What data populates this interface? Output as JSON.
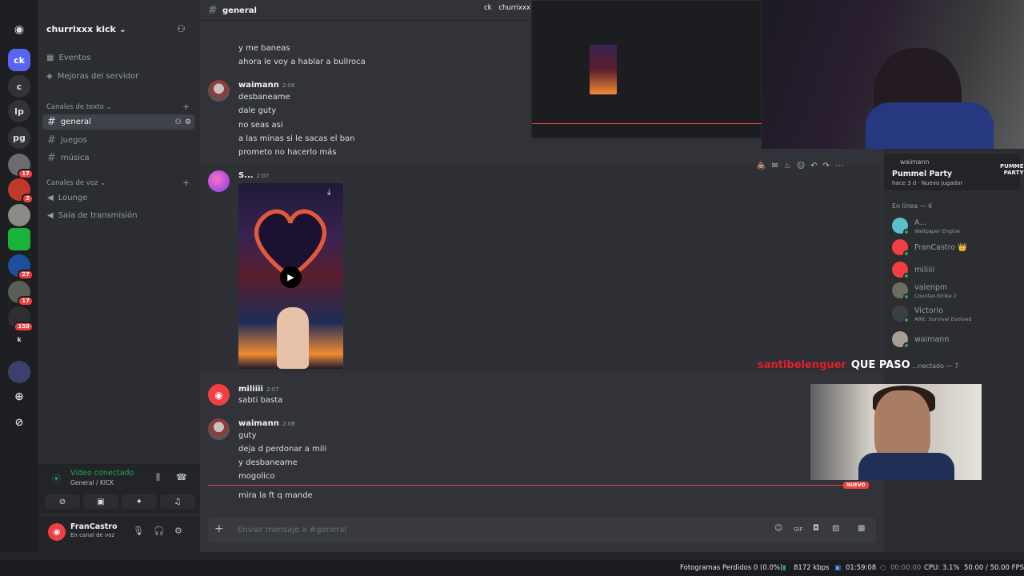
{
  "server": {
    "name": "churrixxx kick"
  },
  "rail": {
    "servers": [
      {
        "label": "ck",
        "badge": ""
      },
      {
        "label": "c",
        "badge": ""
      },
      {
        "label": "lp",
        "badge": ""
      },
      {
        "label": "pg",
        "badge": ""
      },
      {
        "label": "",
        "badge": "17"
      },
      {
        "label": "",
        "badge": "2"
      },
      {
        "label": "",
        "badge": ""
      },
      {
        "label": "",
        "badge": ""
      },
      {
        "label": "",
        "badge": "27"
      },
      {
        "label": "",
        "badge": "17"
      },
      {
        "label": "",
        "badge": "159"
      },
      {
        "label": "k",
        "badge": ""
      },
      {
        "label": "",
        "badge": ""
      }
    ]
  },
  "sidebar": {
    "events": "Eventos",
    "boosts": "Mejoras del servidor",
    "text_category": "Canales de texto",
    "text_channels": [
      "general",
      "juegos",
      "música"
    ],
    "voice_category": "Canales de voz",
    "voice_channels": [
      "Lounge",
      "Sala de transmisión"
    ]
  },
  "voice_status": {
    "title": "Vídeo conectado",
    "subtitle": "General / KICK"
  },
  "user": {
    "name": "FranCastro",
    "status": "En canal de voz"
  },
  "chat": {
    "channel": "general",
    "top_right_label": "churrixxx",
    "messages_top": [
      "y me baneas",
      "ahora le voy a hablar a bullroca"
    ],
    "group1": {
      "author": "waimann",
      "time": "2:06",
      "lines": [
        "desbaneame",
        "dale guty",
        "no seas asi",
        "a las minas si le sacas el ban",
        "prometo no hacerlo más"
      ]
    },
    "group2": {
      "author": "S...",
      "time": "2:07"
    },
    "group3": {
      "author": "miliiii",
      "time": "2:07",
      "lines": [
        "sabti basta"
      ]
    },
    "group4": {
      "author": "waimann",
      "time": "2:08",
      "lines": [
        "guty",
        "deja d perdonar a mili",
        "y desbaneame",
        "mogolico",
        "mira la ft q mande"
      ]
    },
    "new_tag": "NUEVO",
    "input_placeholder": "Enviar mensaje a #general"
  },
  "activity": {
    "user": "waimann",
    "game": "Pummel Party",
    "detail": "hace 3 d · Nuevo jugador",
    "logo": "PUMMEL PARTY"
  },
  "members": {
    "online_header": "En línea — 6",
    "online": [
      {
        "name": "A...",
        "status": "Wallpaper Engine",
        "color": "#5bc0c9"
      },
      {
        "name": "FranCastro 👑",
        "status": "",
        "color": "#f23f43"
      },
      {
        "name": "miliiii",
        "status": "",
        "color": "#f23f43"
      },
      {
        "name": "valenpm",
        "status": "Counter-Strike 2",
        "color": "#6b6e5e"
      },
      {
        "name": "Victorio",
        "status": "ARK: Survival Evolved",
        "color": "#3c3f45"
      },
      {
        "name": "waimann",
        "status": "",
        "color": "#a89d94"
      }
    ],
    "offline_header": "...nectado — 7"
  },
  "overlay": {
    "chat_user": "santibelenguer",
    "chat_msg": "QUE PASO"
  },
  "taskbar": {
    "dropped": "Fotogramas Perdidos 0 (0.0%)",
    "bitrate": "8172 kbps",
    "rec_time": "01:59:08",
    "stream_time": "00:00:00",
    "cpu": "CPU: 3.1%",
    "fps": "50.00 / 50.00 FPS"
  },
  "colors": {
    "accent": "#5865f2",
    "online": "#23a55a",
    "danger": "#f23f43"
  }
}
